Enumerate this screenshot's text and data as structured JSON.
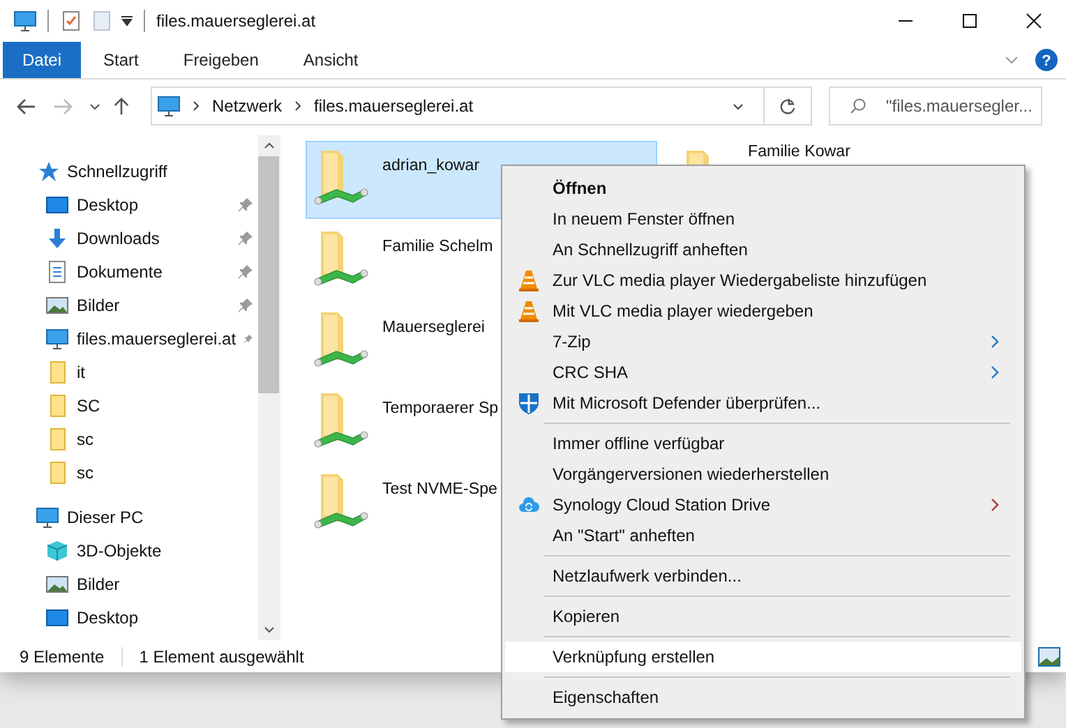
{
  "window": {
    "title": "files.mauerseglerei.at"
  },
  "ribbon_tabs": [
    {
      "label": "Datei",
      "selected": true
    },
    {
      "label": "Start",
      "selected": false
    },
    {
      "label": "Freigeben",
      "selected": false
    },
    {
      "label": "Ansicht",
      "selected": false
    }
  ],
  "help": {
    "label": "?"
  },
  "address_bar": {
    "crumbs": [
      "Netzwerk",
      "files.mauerseglerei.at"
    ]
  },
  "search": {
    "placeholder": "\"files.mauersegler..."
  },
  "navigation": [
    {
      "label": "Schnellzugriff",
      "kind": "star",
      "pinned": false,
      "children": [
        {
          "label": "Desktop",
          "kind": "desktop",
          "pinned": true
        },
        {
          "label": "Downloads",
          "kind": "download",
          "pinned": true
        },
        {
          "label": "Dokumente",
          "kind": "document",
          "pinned": true
        },
        {
          "label": "Bilder",
          "kind": "picture",
          "pinned": true
        },
        {
          "label": "files.mauerseglerei.at",
          "kind": "computer",
          "pinned": true
        },
        {
          "label": "it",
          "kind": "folder",
          "pinned": false
        },
        {
          "label": "SC",
          "kind": "folder",
          "pinned": false
        },
        {
          "label": "sc",
          "kind": "folder",
          "pinned": false
        },
        {
          "label": "sc",
          "kind": "folder",
          "pinned": false
        }
      ]
    },
    {
      "label": "Dieser PC",
      "kind": "computer",
      "pinned": false,
      "children": [
        {
          "label": "3D-Objekte",
          "kind": "cube",
          "pinned": false
        },
        {
          "label": "Bilder",
          "kind": "picture",
          "pinned": false
        },
        {
          "label": "Desktop",
          "kind": "desktop",
          "pinned": false
        }
      ]
    }
  ],
  "files": [
    {
      "name": "adrian_kowar",
      "selected": true
    },
    {
      "name": "Familie Schelm",
      "selected": false
    },
    {
      "name": "Mauerseglerei",
      "selected": false
    },
    {
      "name": "Temporaerer Sp",
      "selected": false
    },
    {
      "name": "Test NVME-Spe",
      "selected": false
    },
    {
      "name": "Familie Kowar",
      "selected": false
    }
  ],
  "status_bar": {
    "count": "9 Elemente",
    "selection": "1 Element ausgewählt"
  },
  "context_menu": [
    [
      {
        "label": "Öffnen",
        "default": true,
        "kind": "plain",
        "submenu": false,
        "selected": false
      },
      {
        "label": "In neuem Fenster öffnen",
        "default": false,
        "kind": "plain",
        "submenu": false,
        "selected": false
      },
      {
        "label": "An Schnellzugriff anheften",
        "default": false,
        "kind": "plain",
        "submenu": false,
        "selected": false
      },
      {
        "label": "Zur VLC media player Wiedergabeliste hinzufügen",
        "default": false,
        "kind": "cone",
        "submenu": false,
        "selected": false
      },
      {
        "label": "Mit VLC media player wiedergeben",
        "default": false,
        "kind": "cone",
        "submenu": false,
        "selected": false
      },
      {
        "label": "7-Zip",
        "default": false,
        "kind": "plain",
        "submenu": true,
        "selected": false
      },
      {
        "label": "CRC SHA",
        "default": false,
        "kind": "plain",
        "submenu": true,
        "selected": false
      },
      {
        "label": "Mit Microsoft Defender überprüfen...",
        "default": false,
        "kind": "shield",
        "submenu": false,
        "selected": false
      }
    ],
    [
      {
        "label": "Immer offline verfügbar",
        "default": false,
        "kind": "plain",
        "submenu": false,
        "selected": false
      },
      {
        "label": "Vorgängerversionen wiederherstellen",
        "default": false,
        "kind": "plain",
        "submenu": false,
        "selected": false
      },
      {
        "label": "Synology Cloud Station Drive",
        "default": false,
        "kind": "cloud",
        "submenu": true,
        "selected": false
      },
      {
        "label": "An \"Start\" anheften",
        "default": false,
        "kind": "plain",
        "submenu": false,
        "selected": false
      }
    ],
    [
      {
        "label": "Netzlaufwerk verbinden...",
        "default": false,
        "kind": "plain",
        "submenu": false,
        "selected": false
      }
    ],
    [
      {
        "label": "Kopieren",
        "default": false,
        "kind": "plain",
        "submenu": false,
        "selected": false
      }
    ],
    [
      {
        "label": "Verknüpfung erstellen",
        "default": false,
        "kind": "plain",
        "submenu": false,
        "selected": true
      }
    ],
    [
      {
        "label": "Eigenschaften",
        "default": false,
        "kind": "plain",
        "submenu": false,
        "selected": false
      }
    ]
  ]
}
